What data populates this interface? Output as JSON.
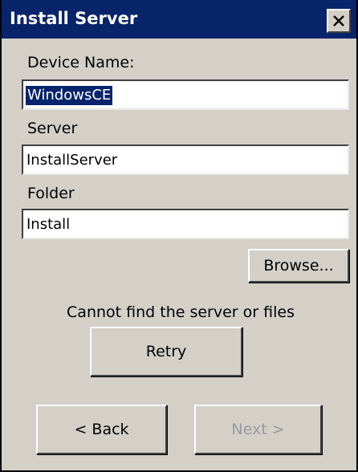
{
  "window": {
    "title": "Install Server",
    "close_label": "close"
  },
  "form": {
    "device_name_label": "Device Name:",
    "device_name_value": "WindowsCE",
    "server_label": "Server",
    "server_value": "InstallServer",
    "folder_label": "Folder",
    "folder_value": "Install"
  },
  "buttons": {
    "browse": "Browse...",
    "retry": "Retry",
    "back": "< Back",
    "next": "Next >"
  },
  "status": {
    "message": "Cannot find the server or files"
  },
  "colors": {
    "titlebar": "#08246b",
    "face": "#d4d0c8",
    "disabled_text": "#9a9a9a"
  },
  "icons": {
    "close": "close-icon"
  }
}
